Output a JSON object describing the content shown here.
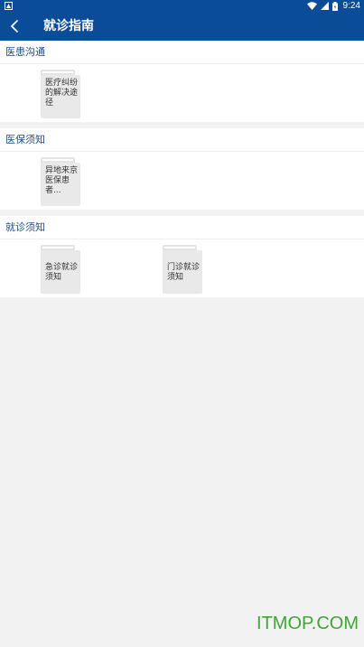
{
  "status_bar": {
    "time": "9:24",
    "icons": [
      "notification-icon",
      "wifi-icon",
      "signal-icon",
      "battery-icon"
    ]
  },
  "app_bar": {
    "title": "就诊指南",
    "back_icon": "chevron-left-icon",
    "color": "#0a4c97"
  },
  "sections": [
    {
      "title": "医患沟通",
      "items": [
        {
          "label": "医疗纠纷的解决途径"
        }
      ]
    },
    {
      "title": "医保须知",
      "items": [
        {
          "label": "异地来京医保患者..."
        }
      ]
    },
    {
      "title": "就诊须知",
      "items": [
        {
          "label": "急诊就诊须知"
        },
        {
          "label": "门诊就诊须知"
        }
      ]
    }
  ],
  "watermark": "ITMOP.COM"
}
